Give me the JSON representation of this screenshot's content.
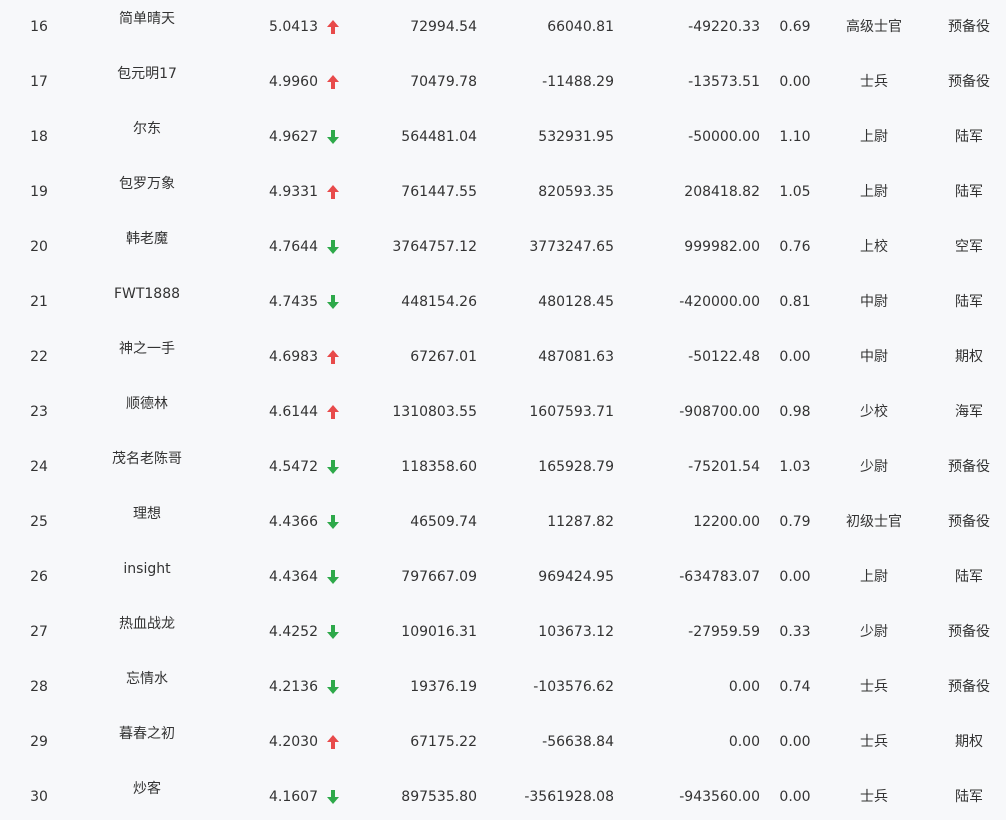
{
  "colors": {
    "background": "#f7f8fa",
    "text": "#333333",
    "up_arrow": "#e84a4a",
    "down_arrow": "#2ea94a"
  },
  "rows": [
    {
      "rank": "16",
      "name": "简单晴天",
      "score": "5.0413",
      "trend": "up",
      "c1": "72994.54",
      "c2": "66040.81",
      "c3": "-49220.33",
      "ratio": "0.69",
      "level": "高级士官",
      "branch": "预备役"
    },
    {
      "rank": "17",
      "name": "包元明17",
      "score": "4.9960",
      "trend": "up",
      "c1": "70479.78",
      "c2": "-11488.29",
      "c3": "-13573.51",
      "ratio": "0.00",
      "level": "士兵",
      "branch": "预备役"
    },
    {
      "rank": "18",
      "name": "尔东",
      "score": "4.9627",
      "trend": "down",
      "c1": "564481.04",
      "c2": "532931.95",
      "c3": "-50000.00",
      "ratio": "1.10",
      "level": "上尉",
      "branch": "陆军"
    },
    {
      "rank": "19",
      "name": "包罗万象",
      "score": "4.9331",
      "trend": "up",
      "c1": "761447.55",
      "c2": "820593.35",
      "c3": "208418.82",
      "ratio": "1.05",
      "level": "上尉",
      "branch": "陆军"
    },
    {
      "rank": "20",
      "name": "韩老魔",
      "score": "4.7644",
      "trend": "down",
      "c1": "3764757.12",
      "c2": "3773247.65",
      "c3": "999982.00",
      "ratio": "0.76",
      "level": "上校",
      "branch": "空军"
    },
    {
      "rank": "21",
      "name": "FWT1888",
      "score": "4.7435",
      "trend": "down",
      "c1": "448154.26",
      "c2": "480128.45",
      "c3": "-420000.00",
      "ratio": "0.81",
      "level": "中尉",
      "branch": "陆军"
    },
    {
      "rank": "22",
      "name": "神之一手",
      "score": "4.6983",
      "trend": "up",
      "c1": "67267.01",
      "c2": "487081.63",
      "c3": "-50122.48",
      "ratio": "0.00",
      "level": "中尉",
      "branch": "期权"
    },
    {
      "rank": "23",
      "name": "顺德林",
      "score": "4.6144",
      "trend": "up",
      "c1": "1310803.55",
      "c2": "1607593.71",
      "c3": "-908700.00",
      "ratio": "0.98",
      "level": "少校",
      "branch": "海军"
    },
    {
      "rank": "24",
      "name": "茂名老陈哥",
      "score": "4.5472",
      "trend": "down",
      "c1": "118358.60",
      "c2": "165928.79",
      "c3": "-75201.54",
      "ratio": "1.03",
      "level": "少尉",
      "branch": "预备役"
    },
    {
      "rank": "25",
      "name": "理想",
      "score": "4.4366",
      "trend": "down",
      "c1": "46509.74",
      "c2": "11287.82",
      "c3": "12200.00",
      "ratio": "0.79",
      "level": "初级士官",
      "branch": "预备役"
    },
    {
      "rank": "26",
      "name": "insight",
      "score": "4.4364",
      "trend": "down",
      "c1": "797667.09",
      "c2": "969424.95",
      "c3": "-634783.07",
      "ratio": "0.00",
      "level": "上尉",
      "branch": "陆军"
    },
    {
      "rank": "27",
      "name": "热血战龙",
      "score": "4.4252",
      "trend": "down",
      "c1": "109016.31",
      "c2": "103673.12",
      "c3": "-27959.59",
      "ratio": "0.33",
      "level": "少尉",
      "branch": "预备役"
    },
    {
      "rank": "28",
      "name": "忘情水",
      "score": "4.2136",
      "trend": "down",
      "c1": "19376.19",
      "c2": "-103576.62",
      "c3": "0.00",
      "ratio": "0.74",
      "level": "士兵",
      "branch": "预备役"
    },
    {
      "rank": "29",
      "name": "暮春之初",
      "score": "4.2030",
      "trend": "up",
      "c1": "67175.22",
      "c2": "-56638.84",
      "c3": "0.00",
      "ratio": "0.00",
      "level": "士兵",
      "branch": "期权"
    },
    {
      "rank": "30",
      "name": "炒客",
      "score": "4.1607",
      "trend": "down",
      "c1": "897535.80",
      "c2": "-3561928.08",
      "c3": "-943560.00",
      "ratio": "0.00",
      "level": "士兵",
      "branch": "陆军"
    }
  ]
}
